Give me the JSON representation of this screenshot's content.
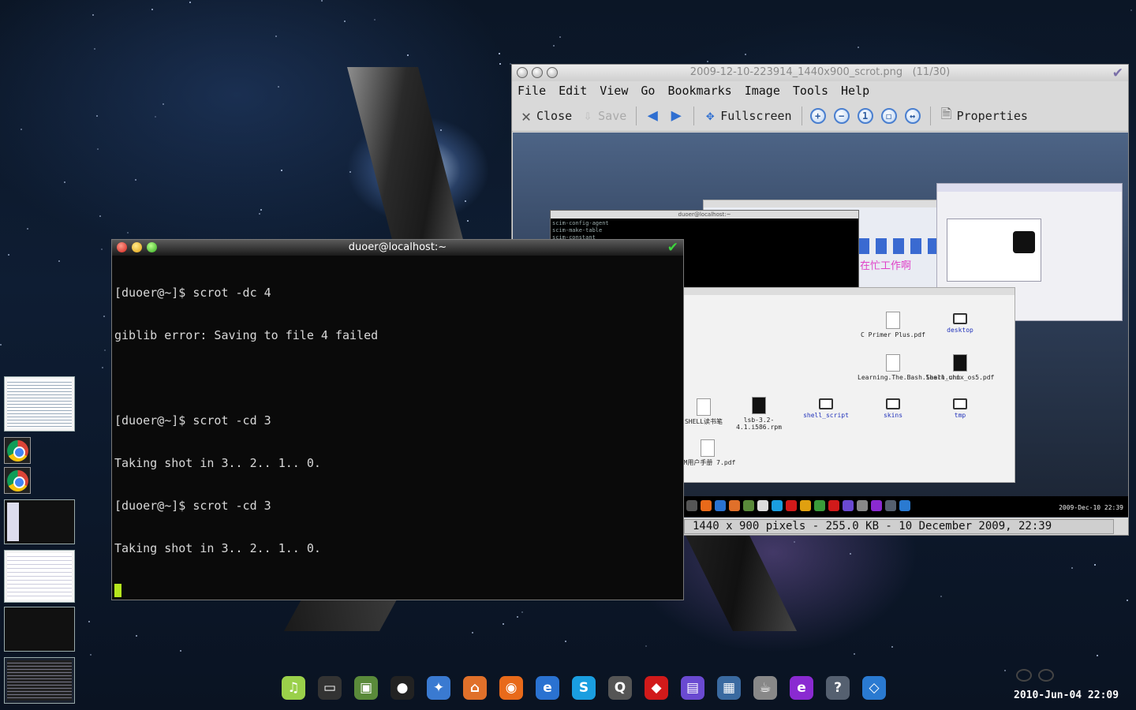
{
  "viewer": {
    "title": "2009-12-10-223914_1440x900_scrot.png",
    "counter": "(11/30)",
    "menu": [
      "File",
      "Edit",
      "View",
      "Go",
      "Bookmarks",
      "Image",
      "Tools",
      "Help"
    ],
    "toolbar": {
      "close": "Close",
      "save": "Save",
      "fullscreen": "Fullscreen",
      "properties": "Properties"
    },
    "status": "1440 x 900 pixels - 255.0 KB - 10 December 2009, 22:39",
    "preview": {
      "terminal_lines": [
        "scim-config-agent",
        "scim-make-table",
        "scim-constant"
      ],
      "pink_text": "在忙工作啊",
      "files": [
        "C Primer Plus.pdf",
        "desktop",
        "Learning.The.Bash.Shell.chm",
        "learn_unix_os5.pdf",
        "lsb-3.2-4.1.i586.rpm",
        "shell_script",
        "skins",
        "tmp",
        "SHELL读书笔",
        "IM用户手册 7.pdf"
      ],
      "clock": "2009-Dec-10   22:39"
    }
  },
  "terminal": {
    "title": "duoer@localhost:~",
    "lines": [
      "[duoer@~]$ scrot -dc 4",
      "giblib error: Saving to file 4 failed",
      "",
      "[duoer@~]$ scrot -cd 3",
      "Taking shot in 3.. 2.. 1.. 0.",
      "[duoer@~]$ scrot -cd 3",
      "Taking shot in 3.. 2.. 1.. 0."
    ]
  },
  "dock": {
    "items": [
      {
        "name": "music-player-icon",
        "color": "#9ad04a",
        "glyph": "♫"
      },
      {
        "name": "terminal-icon",
        "color": "#333333",
        "glyph": "▭"
      },
      {
        "name": "image-viewer-icon",
        "color": "#5a8a3a",
        "glyph": "▣"
      },
      {
        "name": "qq-penguin-icon",
        "color": "#222222",
        "glyph": "●"
      },
      {
        "name": "msn-butterfly-icon",
        "color": "#3a7ad1",
        "glyph": "✦"
      },
      {
        "name": "home-folder-icon",
        "color": "#e0702a",
        "glyph": "⌂"
      },
      {
        "name": "firefox-icon",
        "color": "#e86a1a",
        "glyph": "◉"
      },
      {
        "name": "browser-globe-icon",
        "color": "#2a72d1",
        "glyph": "e"
      },
      {
        "name": "skype-icon",
        "color": "#1a9ee0",
        "glyph": "S"
      },
      {
        "name": "search-icon",
        "color": "#555555",
        "glyph": "Q"
      },
      {
        "name": "security-icon",
        "color": "#d11a1a",
        "glyph": "◆"
      },
      {
        "name": "notes-icon",
        "color": "#6a4ad1",
        "glyph": "▤"
      },
      {
        "name": "photos-icon",
        "color": "#3a6aa0",
        "glyph": "▦"
      },
      {
        "name": "java-cup-icon",
        "color": "#888888",
        "glyph": "☕"
      },
      {
        "name": "emesene-icon",
        "color": "#8a2ad1",
        "glyph": "e"
      },
      {
        "name": "gnome-help-icon",
        "color": "#556070",
        "glyph": "?"
      },
      {
        "name": "virtualbox-icon",
        "color": "#2a7ad1",
        "glyph": "◇"
      }
    ]
  },
  "clock": "2010-Jun-04   22:09"
}
